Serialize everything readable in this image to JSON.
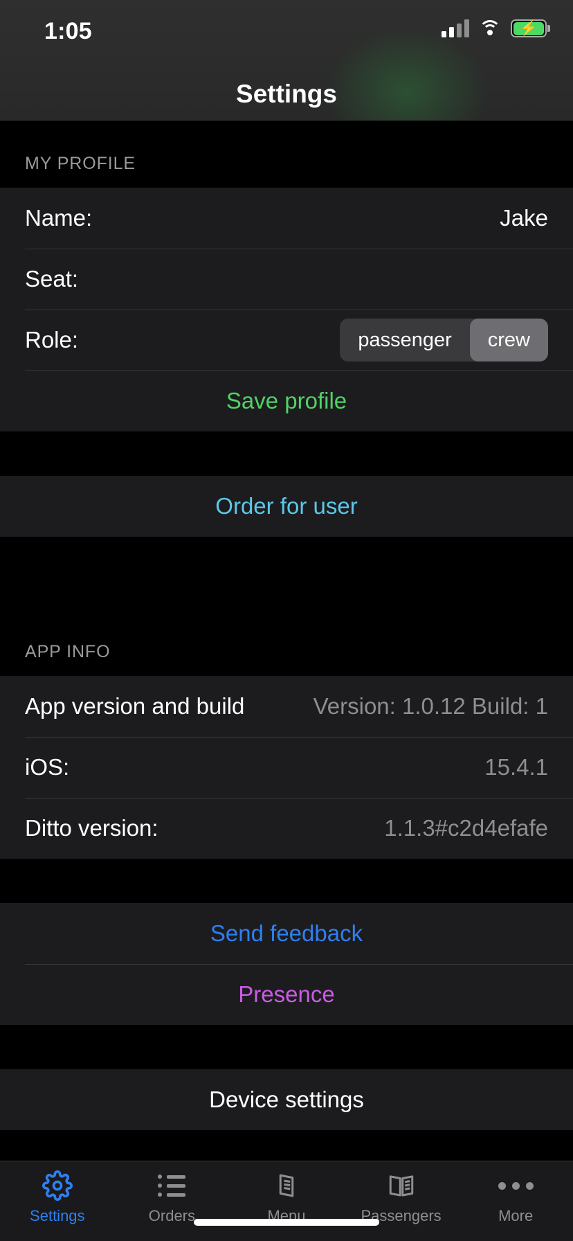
{
  "status_bar": {
    "time": "1:05",
    "cellular_icon": "cellular-signal-icon",
    "wifi_icon": "wifi-icon",
    "battery_icon": "battery-charging-icon",
    "battery_color": "#4cd964"
  },
  "nav": {
    "title": "Settings"
  },
  "profile": {
    "header": "MY PROFILE",
    "name_label": "Name:",
    "name_value": "Jake",
    "seat_label": "Seat:",
    "seat_value": "",
    "role_label": "Role:",
    "role_options": [
      "passenger",
      "crew"
    ],
    "role_selected": "crew",
    "save_label": "Save profile",
    "save_color": "#4fd365"
  },
  "order": {
    "order_for_user_label": "Order for user",
    "order_color": "#5bc8e8"
  },
  "app_info": {
    "header": "APP INFO",
    "rows": [
      {
        "label": "App version and build",
        "value": "Version: 1.0.12 Build: 1"
      },
      {
        "label": "iOS:",
        "value": "15.4.1"
      },
      {
        "label": "Ditto version:",
        "value": "1.1.3#c2d4efafe"
      }
    ]
  },
  "actions": {
    "send_feedback_label": "Send feedback",
    "send_feedback_color": "#2f7ff0",
    "presence_label": "Presence",
    "presence_color": "#cc5ae8",
    "device_settings_label": "Device settings"
  },
  "tabbar": {
    "tabs": [
      {
        "label": "Settings",
        "icon": "gear-icon",
        "active": true
      },
      {
        "label": "Orders",
        "icon": "list-icon",
        "active": false
      },
      {
        "label": "Menu",
        "icon": "book-icon",
        "active": false
      },
      {
        "label": "Passengers",
        "icon": "book-open-icon",
        "active": false
      },
      {
        "label": "More",
        "icon": "ellipsis-icon",
        "active": false
      }
    ],
    "active_color": "#2f7ff0",
    "inactive_color": "#8e8e93"
  }
}
